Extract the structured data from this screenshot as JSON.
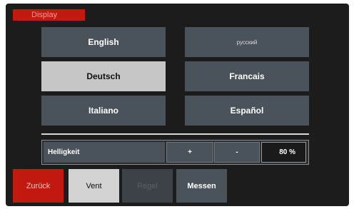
{
  "header": {
    "title": "Display"
  },
  "languages": [
    {
      "label": "English",
      "selected": false
    },
    {
      "label": "русский",
      "selected": false
    },
    {
      "label": "Deutsch",
      "selected": true
    },
    {
      "label": "Francais",
      "selected": false
    },
    {
      "label": "Italiano",
      "selected": false
    },
    {
      "label": "Español",
      "selected": false
    }
  ],
  "brightness": {
    "label": "Helligkeit",
    "increase_label": "+",
    "decrease_label": "-",
    "value_text": "80 %",
    "value_percent": 80
  },
  "bottom_bar": {
    "back_label": "Zurück",
    "vent_label": "Vent",
    "regel_label": "Regel",
    "messen_label": "Messen"
  },
  "colors": {
    "accent_red": "#c21a10",
    "button_gray": "#4b535a",
    "selected_gray": "#c6c6c6",
    "screen_bg": "#1c1c1c"
  }
}
